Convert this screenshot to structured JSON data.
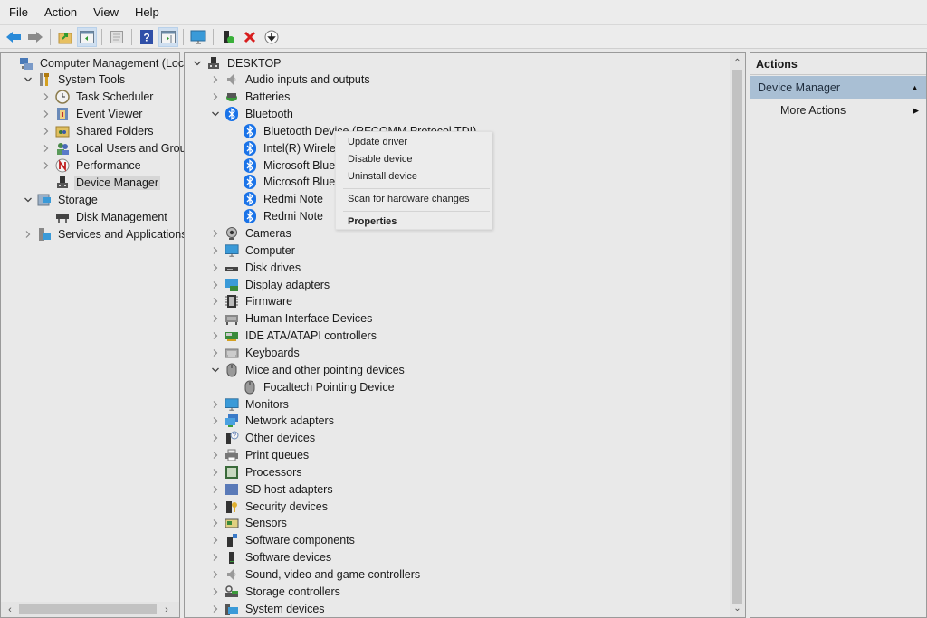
{
  "menu": [
    "File",
    "Action",
    "View",
    "Help"
  ],
  "toolbar": [
    {
      "icon": "back-arrow-icon",
      "label": "Back"
    },
    {
      "icon": "forward-arrow-icon",
      "label": "Forward"
    },
    {
      "icon": "up-folder-icon",
      "label": "Up one level"
    },
    {
      "icon": "show-hide-console-tree-icon",
      "label": "Show/Hide Console Tree",
      "active": true
    },
    {
      "icon": "properties-sheet-icon",
      "label": "Properties"
    },
    {
      "icon": "help-icon",
      "label": "Help"
    },
    {
      "icon": "show-hide-action-pane-icon",
      "label": "Show/Hide Action Pane",
      "active": true
    },
    {
      "icon": "monitor-icon",
      "label": "Display"
    },
    {
      "icon": "update-driver-icon",
      "label": "Update driver"
    },
    {
      "icon": "uninstall-x-icon",
      "label": "Uninstall device"
    },
    {
      "icon": "download-circle-icon",
      "label": "Disable device"
    }
  ],
  "left_tree": [
    {
      "label": "Computer Management (Local",
      "level": 0,
      "icon": "computer-management-icon",
      "chevron": "none"
    },
    {
      "label": "System Tools",
      "level": 1,
      "icon": "tools-icon",
      "chevron": "down"
    },
    {
      "label": "Task Scheduler",
      "level": 2,
      "icon": "clock-icon",
      "chevron": "right"
    },
    {
      "label": "Event Viewer",
      "level": 2,
      "icon": "event-viewer-icon",
      "chevron": "right"
    },
    {
      "label": "Shared Folders",
      "level": 2,
      "icon": "shared-folder-icon",
      "chevron": "right"
    },
    {
      "label": "Local Users and Groups",
      "level": 2,
      "icon": "users-icon",
      "chevron": "right"
    },
    {
      "label": "Performance",
      "level": 2,
      "icon": "performance-icon",
      "chevron": "right"
    },
    {
      "label": "Device Manager",
      "level": 2,
      "icon": "device-manager-icon",
      "chevron": "none",
      "selected": true
    },
    {
      "label": "Storage",
      "level": 1,
      "icon": "storage-icon",
      "chevron": "down"
    },
    {
      "label": "Disk Management",
      "level": 2,
      "icon": "disk-icon",
      "chevron": "none"
    },
    {
      "label": "Services and Applications",
      "level": 1,
      "icon": "services-icon",
      "chevron": "right"
    }
  ],
  "device_tree": [
    {
      "label": "DESKTOP",
      "level": 0,
      "icon": "computer-node-icon",
      "chevron": "down"
    },
    {
      "label": "Audio inputs and outputs",
      "level": 1,
      "icon": "speaker-icon",
      "chevron": "right"
    },
    {
      "label": "Batteries",
      "level": 1,
      "icon": "battery-icon",
      "chevron": "right"
    },
    {
      "label": "Bluetooth",
      "level": 1,
      "icon": "bluetooth-icon",
      "chevron": "down"
    },
    {
      "label": "Bluetooth Device (RFCOMM Protocol TDI)",
      "level": 2,
      "icon": "bluetooth-icon",
      "chevron": "none"
    },
    {
      "label": "Intel(R) Wireless Bluetooth(R)",
      "level": 2,
      "icon": "bluetooth-icon",
      "chevron": "none"
    },
    {
      "label": "Microsoft Bluetooth Enumerator",
      "level": 2,
      "icon": "bluetooth-icon",
      "chevron": "none"
    },
    {
      "label": "Microsoft Bluetooth LE Enumerator",
      "level": 2,
      "icon": "bluetooth-icon",
      "chevron": "none"
    },
    {
      "label": "Redmi Note",
      "level": 2,
      "icon": "bluetooth-icon",
      "chevron": "none"
    },
    {
      "label": "Redmi Note",
      "level": 2,
      "icon": "bluetooth-icon",
      "chevron": "none"
    },
    {
      "label": "Cameras",
      "level": 1,
      "icon": "camera-icon",
      "chevron": "right"
    },
    {
      "label": "Computer",
      "level": 1,
      "icon": "monitor-icon",
      "chevron": "right"
    },
    {
      "label": "Disk drives",
      "level": 1,
      "icon": "disk-drive-icon",
      "chevron": "right"
    },
    {
      "label": "Display adapters",
      "level": 1,
      "icon": "display-adapter-icon",
      "chevron": "right"
    },
    {
      "label": "Firmware",
      "level": 1,
      "icon": "firmware-chip-icon",
      "chevron": "right"
    },
    {
      "label": "Human Interface Devices",
      "level": 1,
      "icon": "hid-icon",
      "chevron": "right"
    },
    {
      "label": "IDE ATA/ATAPI controllers",
      "level": 1,
      "icon": "ide-controller-icon",
      "chevron": "right"
    },
    {
      "label": "Keyboards",
      "level": 1,
      "icon": "keyboard-icon",
      "chevron": "right"
    },
    {
      "label": "Mice and other pointing devices",
      "level": 1,
      "icon": "mouse-icon",
      "chevron": "down"
    },
    {
      "label": "Focaltech Pointing Device",
      "level": 2,
      "icon": "mouse-icon",
      "chevron": "none"
    },
    {
      "label": "Monitors",
      "level": 1,
      "icon": "monitor-icon",
      "chevron": "right"
    },
    {
      "label": "Network adapters",
      "level": 1,
      "icon": "network-icon",
      "chevron": "right"
    },
    {
      "label": "Other devices",
      "level": 1,
      "icon": "unknown-device-icon",
      "chevron": "right"
    },
    {
      "label": "Print queues",
      "level": 1,
      "icon": "printer-icon",
      "chevron": "right"
    },
    {
      "label": "Processors",
      "level": 1,
      "icon": "processor-icon",
      "chevron": "right"
    },
    {
      "label": "SD host adapters",
      "level": 1,
      "icon": "sd-adapter-icon",
      "chevron": "right"
    },
    {
      "label": "Security devices",
      "level": 1,
      "icon": "security-key-icon",
      "chevron": "right"
    },
    {
      "label": "Sensors",
      "level": 1,
      "icon": "sensor-icon",
      "chevron": "right"
    },
    {
      "label": "Software components",
      "level": 1,
      "icon": "software-component-icon",
      "chevron": "right"
    },
    {
      "label": "Software devices",
      "level": 1,
      "icon": "software-device-icon",
      "chevron": "right"
    },
    {
      "label": "Sound, video and game controllers",
      "level": 1,
      "icon": "speaker-icon",
      "chevron": "right"
    },
    {
      "label": "Storage controllers",
      "level": 1,
      "icon": "storage-controller-icon",
      "chevron": "right"
    },
    {
      "label": "System devices",
      "level": 1,
      "icon": "system-folder-icon",
      "chevron": "right"
    }
  ],
  "context_menu": {
    "items": [
      {
        "label": "Update driver"
      },
      {
        "label": "Disable device"
      },
      {
        "label": "Uninstall device"
      },
      {
        "separator": true
      },
      {
        "label": "Scan for hardware changes"
      },
      {
        "separator": true
      },
      {
        "label": "Properties",
        "bold": true
      }
    ]
  },
  "actions": {
    "header": "Actions",
    "section": "Device Manager",
    "items": [
      "More Actions"
    ]
  },
  "colors": {
    "bluetooth": "#1a73e8",
    "actions_section_bg": "#a9bfd4",
    "uninstall_red": "#d81e1e"
  }
}
